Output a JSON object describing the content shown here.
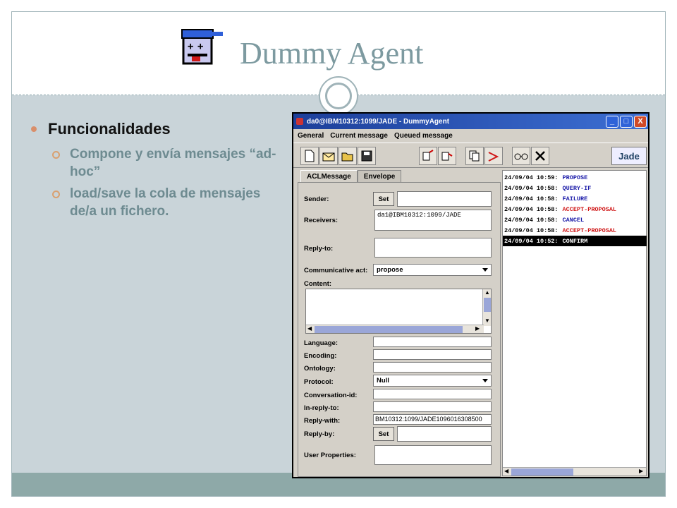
{
  "slide": {
    "title": "Dummy Agent",
    "bullet": "Funcionalidades",
    "subbullets": [
      "Compone y envía mensajes “ad-hoc”",
      "load/save  la cola de mensajes de/a un fichero."
    ]
  },
  "window": {
    "title": "da0@IBM10312:1099/JADE - DummyAgent",
    "controls": {
      "minimize": "_",
      "maximize": "□",
      "close": "X"
    },
    "menu": [
      "General",
      "Current message",
      "Queued message"
    ],
    "jade_logo": "Jade",
    "tabs": [
      "ACLMessage",
      "Envelope"
    ],
    "form": {
      "sender_label": "Sender:",
      "set_label": "Set",
      "receivers_label": "Receivers:",
      "receivers_value": "da1@IBM10312:1099/JADE",
      "reply_to_label": "Reply-to:",
      "communicative_act_label": "Communicative act:",
      "communicative_act_value": "propose",
      "content_label": "Content:",
      "language_label": "Language:",
      "encoding_label": "Encoding:",
      "ontology_label": "Ontology:",
      "protocol_label": "Protocol:",
      "protocol_value": "Null",
      "conversation_id_label": "Conversation-id:",
      "in_reply_to_label": "In-reply-to:",
      "reply_with_label": "Reply-with:",
      "reply_with_value": "BM10312:1099/JADE1096016308500",
      "reply_by_label": "Reply-by:",
      "user_properties_label": "User Properties:"
    },
    "queue": [
      {
        "time": "24/09/04 10:59:",
        "performative": "PROPOSE",
        "color": "#1a1aa8"
      },
      {
        "time": "24/09/04 10:58:",
        "performative": "QUERY-IF",
        "color": "#1a1aa8"
      },
      {
        "time": "24/09/04 10:58:",
        "performative": "FAILURE",
        "color": "#1a1aa8"
      },
      {
        "time": "24/09/04 10:58:",
        "performative": "ACCEPT-PROPOSAL",
        "color": "#d01818"
      },
      {
        "time": "24/09/04 10:58:",
        "performative": "CANCEL",
        "color": "#1a1aa8"
      },
      {
        "time": "24/09/04 10:58:",
        "performative": "ACCEPT-PROPOSAL",
        "color": "#d01818"
      },
      {
        "time": "24/09/04 10:52:",
        "performative": "CONFIRM",
        "color": "#ffffff"
      }
    ]
  }
}
